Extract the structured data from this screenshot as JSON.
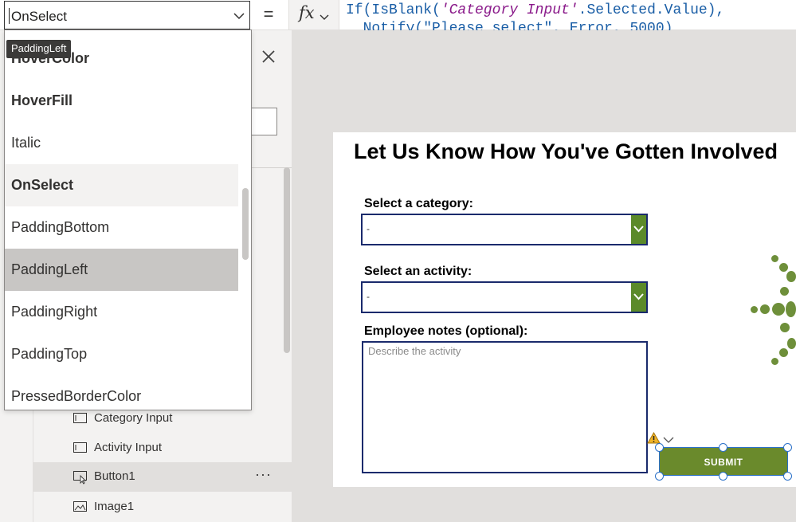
{
  "formula_bar": {
    "property": "OnSelect",
    "equals": "=",
    "fx": "fx",
    "line1": {
      "fn": "If(IsBlank(",
      "str": "'Category Input'",
      "rest": ".Selected.Value),"
    },
    "line2": {
      "text": "  Notify(\"Please select\", Error, 5000)"
    }
  },
  "property_list": {
    "tooltip": "PaddingLeft",
    "items": [
      {
        "label": "HoverColor",
        "bold": true
      },
      {
        "label": "HoverFill",
        "bold": true
      },
      {
        "label": "Italic",
        "bold": false
      },
      {
        "label": "OnSelect",
        "bold": true
      },
      {
        "label": "PaddingBottom",
        "bold": false
      },
      {
        "label": "PaddingLeft",
        "bold": false
      },
      {
        "label": "PaddingRight",
        "bold": false
      },
      {
        "label": "PaddingTop",
        "bold": false
      },
      {
        "label": "PressedBorderColor",
        "bold": false
      }
    ]
  },
  "tree": {
    "items": [
      {
        "label": "Category Input",
        "icon": "textinput-icon"
      },
      {
        "label": "Activity Input",
        "icon": "textinput-icon"
      },
      {
        "label": "Button1",
        "icon": "button-icon",
        "more": "···"
      },
      {
        "label": "Image1",
        "icon": "image-icon"
      }
    ]
  },
  "form": {
    "heading": "Let Us Know How You've Gotten Involved",
    "category_label": "Select a category:",
    "category_value": "-",
    "activity_label": "Select an activity:",
    "activity_value": "-",
    "notes_label": "Employee notes (optional):",
    "notes_placeholder": "Describe the activity",
    "submit_label": "SUBMIT"
  },
  "colors": {
    "accent_green": "#6a8a2c",
    "dropdown_border": "#1a2a6c",
    "selection_blue": "#2a70c8"
  }
}
